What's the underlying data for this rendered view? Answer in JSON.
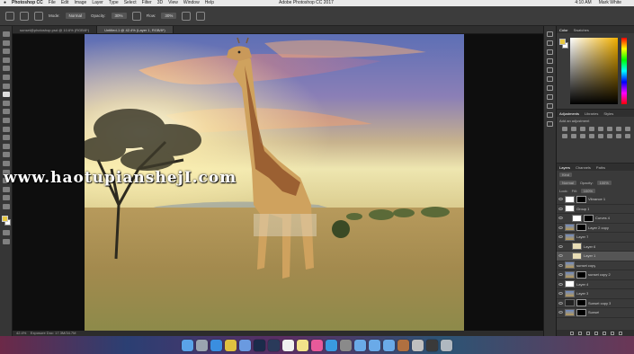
{
  "menubar": {
    "app_name": "Photoshop CC",
    "items": [
      "File",
      "Edit",
      "Image",
      "Layer",
      "Type",
      "Select",
      "Filter",
      "3D",
      "View",
      "Window",
      "Help"
    ],
    "center_title": "Adobe Photoshop CC 2017",
    "clock": "4:10 AM",
    "user": "Mark White"
  },
  "options": {
    "mode_label": "Mode:",
    "mode_value": "Normal",
    "opacity_label": "Opacity:",
    "opacity_value": "30%",
    "flow_label": "Flow:",
    "flow_value": "30%"
  },
  "tabs": [
    {
      "label": "sunset@photoshop.psd @ 10.6% (RGB/8*)"
    },
    {
      "label": "Untitled-1 @ 42.4% (Layer 1, RGB/8*)"
    }
  ],
  "status": {
    "zoom": "42.4%",
    "doc": "Exposure Doc: 17.3M/34.7M"
  },
  "panels": {
    "color_tabs": [
      "Color",
      "Swatches"
    ],
    "adjust_tabs": [
      "Adjustments",
      "Libraries",
      "Styles"
    ],
    "adjust_subtitle": "Add an adjustment",
    "layer_tabs": [
      "Layers",
      "Channels",
      "Paths"
    ],
    "kind_label": "Kind",
    "blend_value": "Normal",
    "opacity_label": "Opacity:",
    "opacity_value": "100%",
    "lock_label": "Lock:",
    "fill_label": "Fill:",
    "fill_value": "100%",
    "layers": [
      {
        "name": "Vibrance 1",
        "thumb": "white",
        "mask": true,
        "indent": 0,
        "selected": false
      },
      {
        "name": "Group 1",
        "thumb": "white",
        "mask": false,
        "indent": 0,
        "selected": false
      },
      {
        "name": "Curves 4",
        "thumb": "white",
        "mask": true,
        "indent": 1,
        "selected": false
      },
      {
        "name": "Layer 2 copy",
        "thumb": "photo",
        "mask": true,
        "indent": 0,
        "selected": false
      },
      {
        "name": "Layer 7",
        "thumb": "photo",
        "mask": false,
        "indent": 0,
        "selected": false
      },
      {
        "name": "Layer 6",
        "thumb": "beige",
        "mask": false,
        "indent": 1,
        "selected": false
      },
      {
        "name": "Layer 1",
        "thumb": "beige",
        "mask": false,
        "indent": 1,
        "selected": true
      },
      {
        "name": "sunset copy",
        "thumb": "photo",
        "mask": false,
        "indent": 0,
        "selected": false
      },
      {
        "name": "sunset copy 2",
        "thumb": "photo",
        "mask": true,
        "indent": 0,
        "selected": false
      },
      {
        "name": "Layer 4",
        "thumb": "white",
        "mask": false,
        "indent": 0,
        "selected": false
      },
      {
        "name": "Layer 3",
        "thumb": "photo",
        "mask": false,
        "indent": 0,
        "selected": false
      },
      {
        "name": "Sunset copy 3",
        "thumb": "dark",
        "mask": true,
        "indent": 0,
        "selected": false
      },
      {
        "name": "Sunset",
        "thumb": "photo",
        "mask": true,
        "indent": 0,
        "selected": false
      }
    ]
  },
  "watermark": "www.haotupianshejI.com",
  "colors": {
    "foreground": "#e8c840",
    "background": "#ffffff",
    "accent": "#f2b000"
  },
  "dock_icons": [
    "finder-icon",
    "launchpad-icon",
    "safari-icon",
    "chrome-icon",
    "mail-icon",
    "photoshop-icon",
    "lightroom-icon",
    "calendar-icon",
    "notes-icon",
    "itunes-icon",
    "appstore-icon",
    "settings-icon",
    "folder-icon",
    "folder-icon",
    "folder-icon",
    "photo-icon",
    "script-icon",
    "screenshot-icon",
    "trash-icon"
  ]
}
